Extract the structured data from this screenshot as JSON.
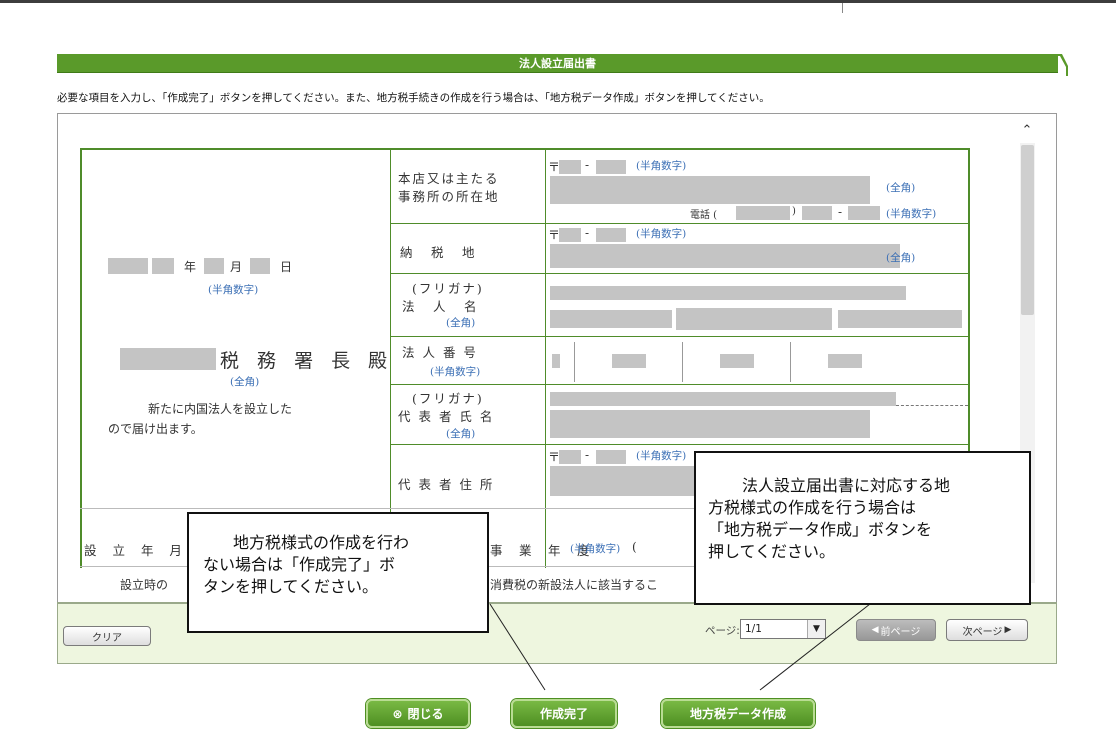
{
  "window": {
    "title": "法人設立届出書",
    "instruction": "必要な項目を入力し、「作成完了」ボタンを押してください。また、地方税手続きの作成を行う場合は、「地方税データ作成」ボタンを押してください。"
  },
  "form": {
    "date": {
      "year": "年",
      "month": "月",
      "day": "日",
      "hint": "(半角数字)"
    },
    "office": {
      "suffix": "税 務 署 長 殿",
      "hint": "(全角)"
    },
    "notice_line1": "新たに内国法人を設立した",
    "notice_line2": "ので届け出ます。",
    "rows": {
      "head_office_line1": "本店又は主たる",
      "head_office_line2": "事務所の所在地",
      "tax_place": "納　税　地",
      "corp_kana": "(フリガナ)",
      "corp_name": "法　人　名",
      "corp_name_hint": "(全角)",
      "corp_number": "法 人 番 号",
      "corp_number_hint": "(半角数字)",
      "rep_kana": "(フリガナ)",
      "rep_name": "代 表 者 氏 名",
      "rep_name_hint": "(全角)",
      "rep_address": "代 表 者 住 所"
    },
    "postal_mark": "〒",
    "dash": "-",
    "hint_halfwidth": "(半角数字)",
    "hint_fullwidth": "(全角)",
    "phone_label": "電話 (",
    "phone_close": ")",
    "bottom_left": "設 立 年 月",
    "bottom_mid_label": "事　業　年　度",
    "bottom_mid_hint": "(半角数字)",
    "bottom_paren": "(",
    "row2_left": "設立時の",
    "row2_mid": "消費税の新設法人に該当するこ"
  },
  "toolbar": {
    "clear": "クリア",
    "page_label": "ページ:",
    "page_value": "1/1",
    "prev": "前ページ",
    "next": "次ページ"
  },
  "actions": {
    "close": "閉じる",
    "complete": "作成完了",
    "local_tax": "地方税データ作成"
  },
  "callouts": {
    "left": [
      "地方税様式の作成を行わ",
      "ない場合は「作成完了」ボ",
      "タンを押してください。"
    ],
    "right": [
      "法人設立届出書に対応する地",
      "方税様式の作成を行う場合は",
      "「地方税データ作成」ボタンを",
      "押してください。"
    ]
  },
  "colors": {
    "title_green": "#5a9a2a",
    "hint_blue": "#3b6fb5",
    "button_green": "#5b9c2c"
  }
}
